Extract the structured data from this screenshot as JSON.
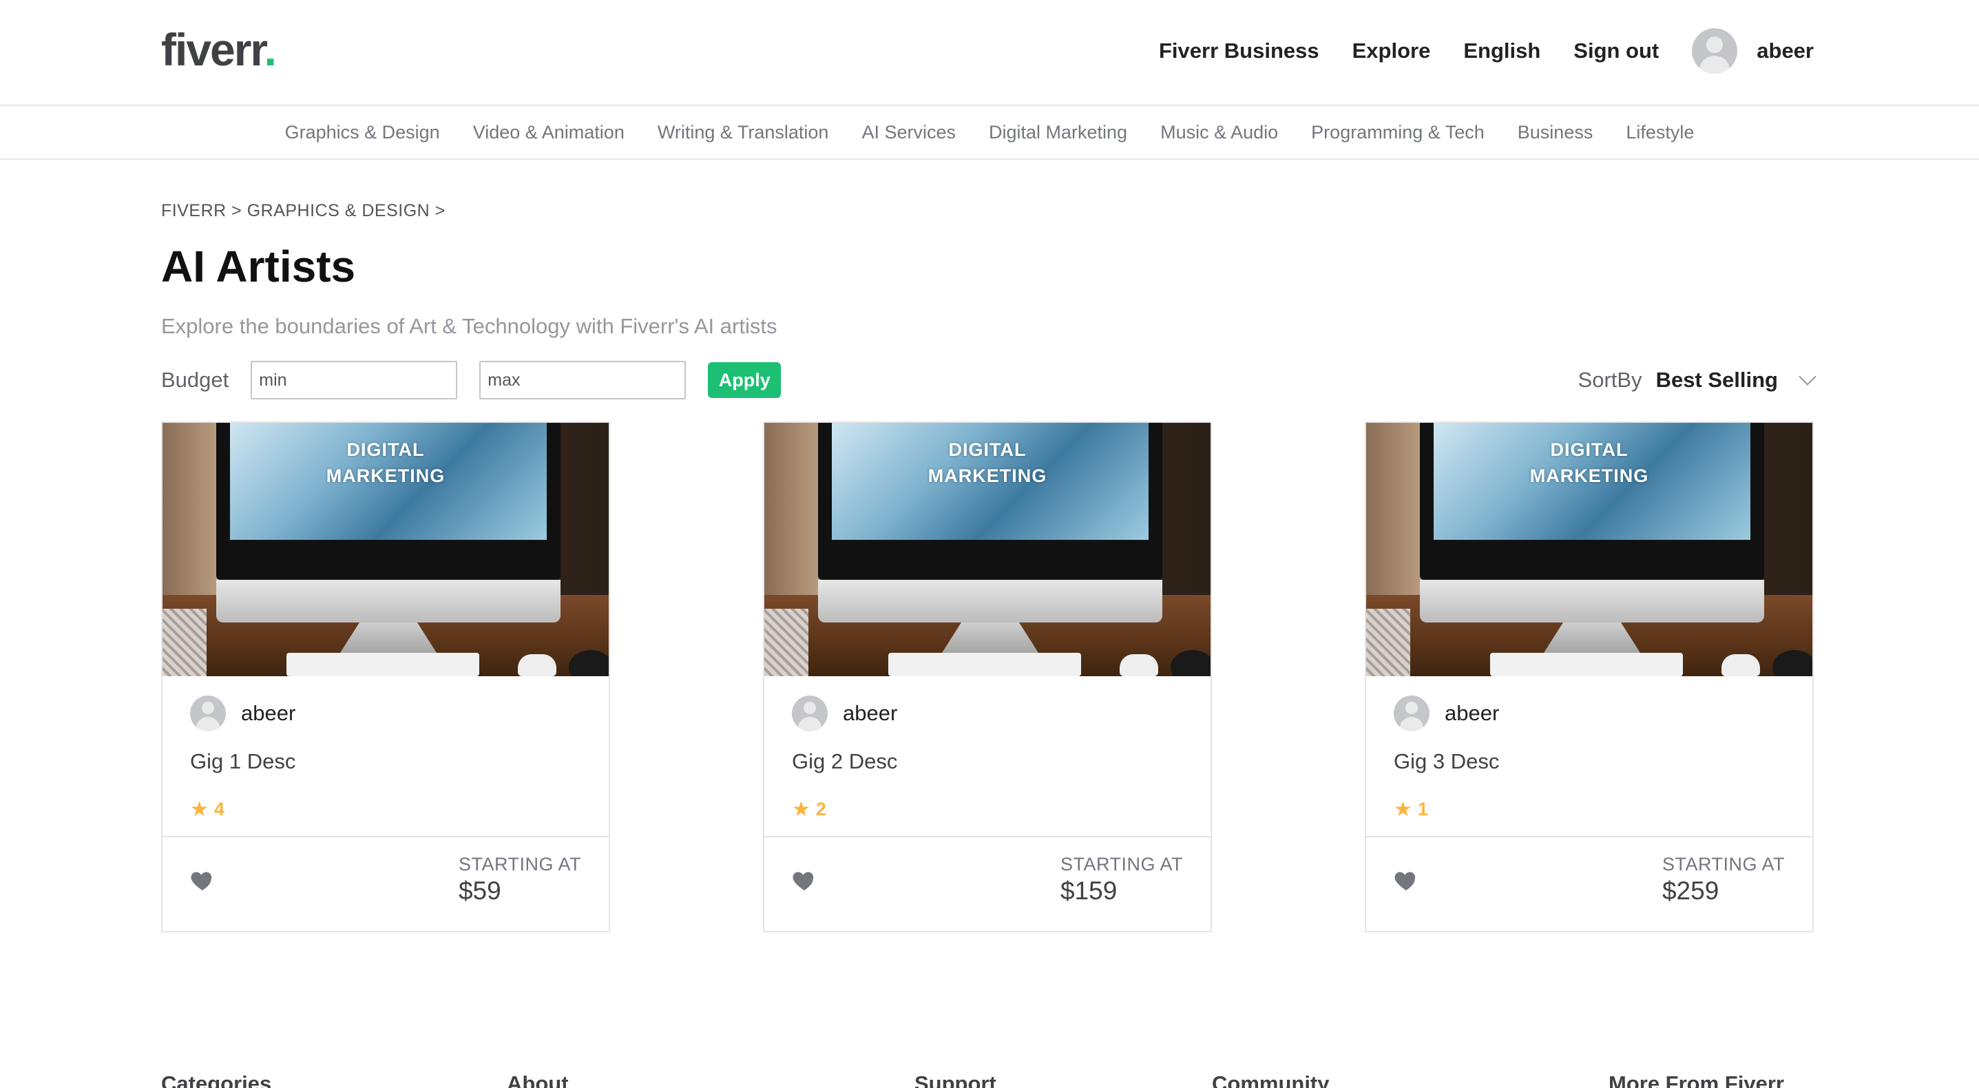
{
  "header": {
    "logo_text": "fiverr",
    "logo_dot": ".",
    "nav": [
      "Fiverr Business",
      "Explore",
      "English",
      "Sign out"
    ],
    "username": "abeer"
  },
  "categories": [
    "Graphics & Design",
    "Video & Animation",
    "Writing & Translation",
    "AI Services",
    "Digital Marketing",
    "Music & Audio",
    "Programming & Tech",
    "Business",
    "Lifestyle"
  ],
  "breadcrumb": [
    "FIVERR",
    ">",
    "GRAPHICS & DESIGN",
    ">"
  ],
  "page": {
    "title": "AI Artists",
    "subtitle": "Explore the boundaries of Art & Technology with Fiverr's AI artists"
  },
  "filters": {
    "budget_label": "Budget",
    "min_placeholder": "min",
    "max_placeholder": "max",
    "apply_label": "Apply",
    "sort_label": "SortBy",
    "sort_value": "Best Selling"
  },
  "gigs": [
    {
      "image_text_1": "DIGITAL",
      "image_text_2": "MARKETING",
      "seller": "abeer",
      "desc": "Gig 1 Desc",
      "rating": "4",
      "price_label": "STARTING AT",
      "price": "$59"
    },
    {
      "image_text_1": "DIGITAL",
      "image_text_2": "MARKETING",
      "seller": "abeer",
      "desc": "Gig 2 Desc",
      "rating": "2",
      "price_label": "STARTING AT",
      "price": "$159"
    },
    {
      "image_text_1": "DIGITAL",
      "image_text_2": "MARKETING",
      "seller": "abeer",
      "desc": "Gig 3 Desc",
      "rating": "1",
      "price_label": "STARTING AT",
      "price": "$259"
    }
  ],
  "footer": {
    "headings": [
      "Categories",
      "About",
      "Support",
      "Community",
      "More From Fiverr"
    ]
  },
  "colors": {
    "brand_green": "#1dbf73",
    "star": "#ffb33e",
    "text_dark": "#222222",
    "text_muted": "#74767e",
    "border": "#e4e5e7"
  },
  "icons": [
    "avatar-icon",
    "chevron-down-icon",
    "star-icon",
    "heart-icon"
  ]
}
